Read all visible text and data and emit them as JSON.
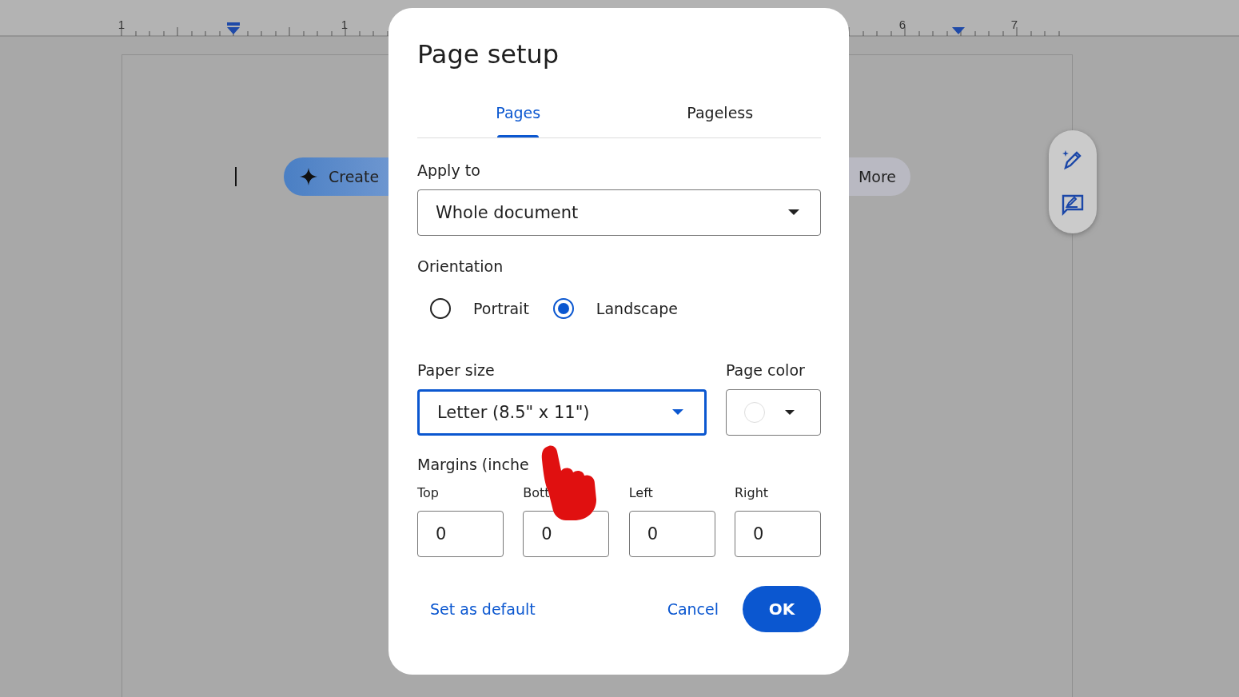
{
  "ruler": {
    "labels": [
      "1",
      "1",
      "6",
      "7"
    ]
  },
  "document": {
    "chips": [
      {
        "label": "Create"
      },
      {
        "label": "More"
      }
    ]
  },
  "dialog": {
    "title": "Page setup",
    "tabs": [
      {
        "label": "Pages",
        "selected": true
      },
      {
        "label": "Pageless",
        "selected": false
      }
    ],
    "apply_to": {
      "label": "Apply to",
      "value": "Whole document"
    },
    "orientation": {
      "label": "Orientation",
      "options": [
        {
          "label": "Portrait",
          "selected": false
        },
        {
          "label": "Landscape",
          "selected": true
        }
      ]
    },
    "paper_size": {
      "label": "Paper size",
      "value": "Letter (8.5\" x 11\")",
      "focused": true
    },
    "page_color": {
      "label": "Page color"
    },
    "margins": {
      "label": "Margins (inche",
      "fields": [
        {
          "label": "Top",
          "value": "0"
        },
        {
          "label": "Bott",
          "value": "0"
        },
        {
          "label": "Left",
          "value": "0"
        },
        {
          "label": "Right",
          "value": "0"
        }
      ]
    },
    "buttons": {
      "set_default": "Set as default",
      "cancel": "Cancel",
      "ok": "OK"
    }
  }
}
